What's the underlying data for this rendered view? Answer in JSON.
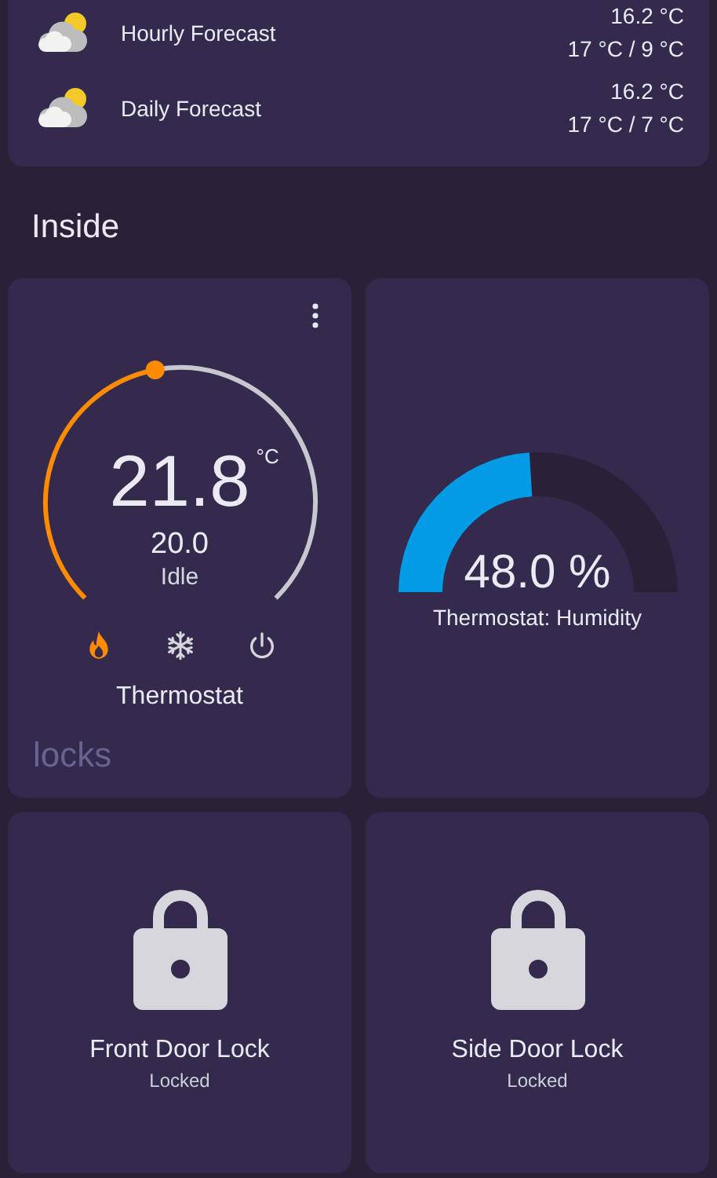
{
  "weather": {
    "rows": [
      {
        "name": "Hourly Forecast",
        "temperature": "16.2 °C",
        "range": "17 °C / 9 °C"
      },
      {
        "name": "Daily Forecast",
        "temperature": "16.2 °C",
        "range": "17 °C / 7 °C"
      }
    ]
  },
  "section_title": "Inside",
  "thermostat": {
    "current": "21.8",
    "unit": "°C",
    "target": "20.0",
    "action": "Idle",
    "level": 0.46,
    "name": "Thermostat",
    "modes": [
      {
        "kind": "heat",
        "selected": true
      },
      {
        "kind": "cool",
        "selected": false
      },
      {
        "kind": "off",
        "selected": false
      }
    ]
  },
  "next_section_title": "locks",
  "humidity": {
    "value": "48.0 %",
    "level": 0.48,
    "name": "Thermostat: Humidity"
  },
  "locks": [
    {
      "name": "Front Door Lock",
      "state": "Locked",
      "locked": true
    },
    {
      "name": "Side Door Lock",
      "state": "Locked",
      "locked": true
    }
  ]
}
